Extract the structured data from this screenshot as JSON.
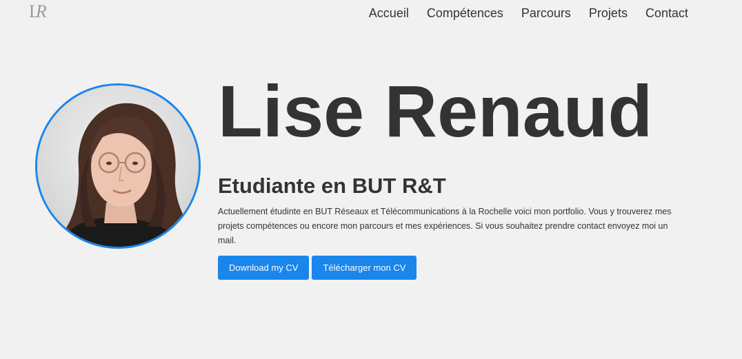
{
  "logo": {
    "text_main": "L",
    "text_sub": "R"
  },
  "nav": {
    "items": [
      "Accueil",
      "Compétences",
      "Parcours",
      "Projets",
      "Contact"
    ]
  },
  "hero": {
    "name": "Lise Renaud",
    "subtitle": "Etudiante en BUT R&T",
    "description": "Actuellement étudinte en BUT Réseaux et Télécommunications à la Rochelle voici mon portfolio. Vous y trouverez mes projets compétences ou encore mon parcours et mes expériences. Si vous souhaitez prendre contact envoyez moi un mail.",
    "buttons": {
      "download_en": "Download my CV",
      "download_fr": "Télécharger mon CV"
    }
  },
  "colors": {
    "accent": "#1a85ea",
    "background": "#f1f1f1",
    "text": "#333333"
  }
}
